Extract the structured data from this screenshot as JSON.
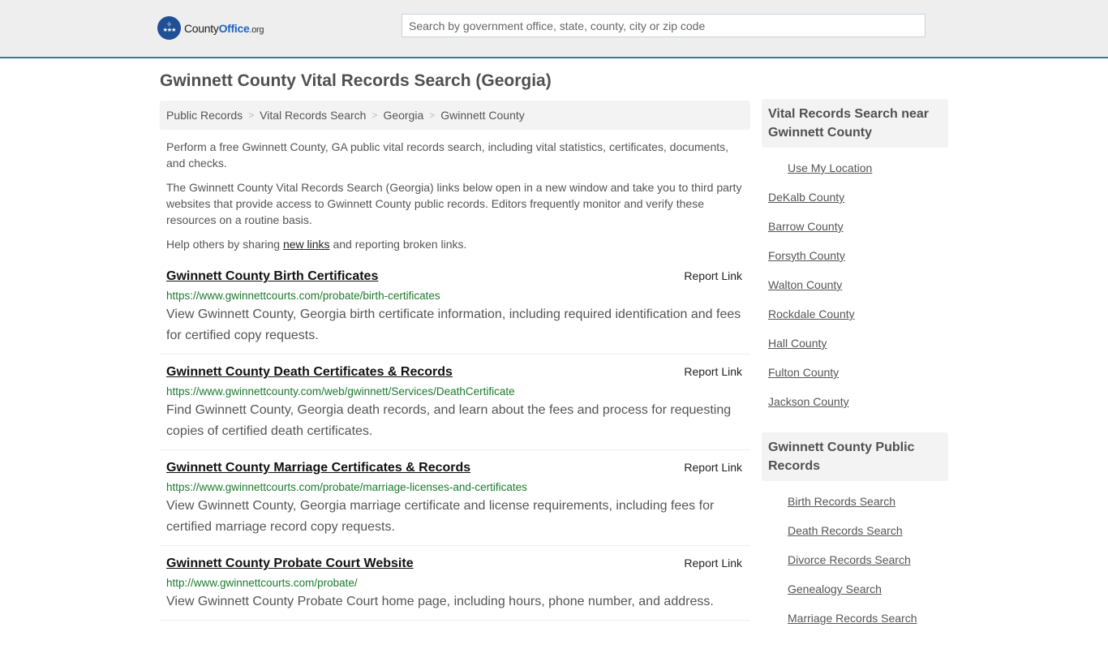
{
  "header": {
    "logo": {
      "name_part1": "County",
      "name_part2": "Office",
      "tld": ".org"
    },
    "search": {
      "placeholder": "Search by government office, state, county, city or zip code",
      "value": ""
    }
  },
  "page_title": "Gwinnett County Vital Records Search (Georgia)",
  "breadcrumb": [
    {
      "label": "Public Records"
    },
    {
      "label": "Vital Records Search"
    },
    {
      "label": "Georgia"
    },
    {
      "label": "Gwinnett County"
    }
  ],
  "intro": {
    "p1": "Perform a free Gwinnett County, GA public vital records search, including vital statistics, certificates, documents, and checks.",
    "p2": "The Gwinnett County Vital Records Search (Georgia) links below open in a new window and take you to third party websites that provide access to Gwinnett County public records. Editors frequently monitor and verify these resources on a routine basis.",
    "p3_before": "Help others by sharing ",
    "p3_link": "new links",
    "p3_after": " and reporting broken links."
  },
  "results": [
    {
      "title": "Gwinnett County Birth Certificates",
      "report_label": "Report Link",
      "url": "https://www.gwinnettcourts.com/probate/birth-certificates",
      "description": "View Gwinnett County, Georgia birth certificate information, including required identification and fees for certified copy requests."
    },
    {
      "title": "Gwinnett County Death Certificates & Records",
      "report_label": "Report Link",
      "url": "https://www.gwinnettcounty.com/web/gwinnett/Services/DeathCertificate",
      "description": "Find Gwinnett County, Georgia death records, and learn about the fees and process for requesting copies of certified death certificates."
    },
    {
      "title": "Gwinnett County Marriage Certificates & Records",
      "report_label": "Report Link",
      "url": "https://www.gwinnettcourts.com/probate/marriage-licenses-and-certificates",
      "description": "View Gwinnett County, Georgia marriage certificate and license requirements, including fees for certified marriage record copy requests."
    },
    {
      "title": "Gwinnett County Probate Court Website",
      "report_label": "Report Link",
      "url": "http://www.gwinnettcourts.com/probate/",
      "description": "View Gwinnett County Probate Court home page, including hours, phone number, and address."
    }
  ],
  "sidebar": {
    "nearby": {
      "heading": "Vital Records Search near Gwinnett County",
      "use_location": "Use My Location",
      "counties": [
        "DeKalb County",
        "Barrow County",
        "Forsyth County",
        "Walton County",
        "Rockdale County",
        "Hall County",
        "Fulton County",
        "Jackson County"
      ]
    },
    "public_records": {
      "heading": "Gwinnett County Public Records",
      "links": [
        "Birth Records Search",
        "Death Records Search",
        "Divorce Records Search",
        "Genealogy Search",
        "Marriage Records Search"
      ]
    }
  },
  "colors": {
    "header_bg": "#eeeeee",
    "header_border": "#3a75b0",
    "logo_blue": "#1f4f95",
    "url_green": "#1c7a2e"
  }
}
